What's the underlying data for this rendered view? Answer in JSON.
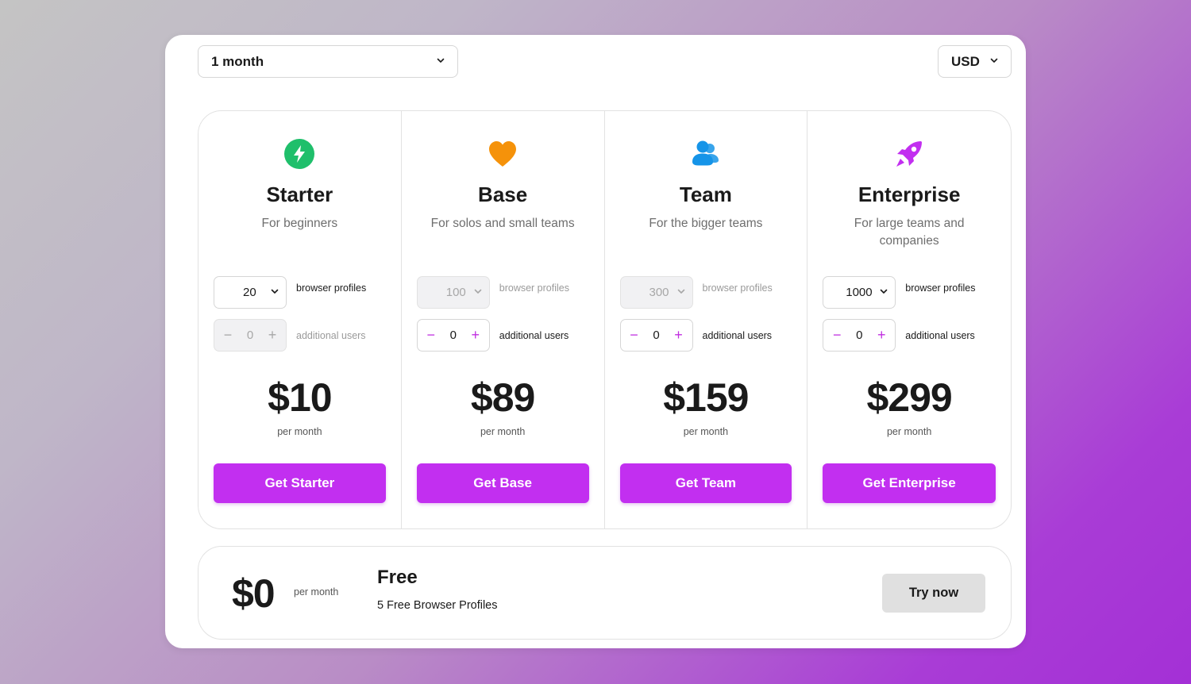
{
  "period_select": {
    "value": "1 month"
  },
  "currency_select": {
    "value": "USD"
  },
  "plans": [
    {
      "name": "Starter",
      "description": "For beginners",
      "icon": "lightning-icon",
      "icon_color": "#1fbf6b",
      "profiles": {
        "value": "20",
        "label": "browser profiles",
        "disabled": false
      },
      "users": {
        "value": "0",
        "minus": "−",
        "plus": "+",
        "label": "additional users",
        "disabled": true
      },
      "price": "$10",
      "per": "per month",
      "button": "Get Starter"
    },
    {
      "name": "Base",
      "description": "For solos and small teams",
      "icon": "heart-icon",
      "icon_color": "#f5920a",
      "profiles": {
        "value": "100",
        "label": "browser profiles",
        "disabled": true
      },
      "users": {
        "value": "0",
        "minus": "−",
        "plus": "+",
        "label": "additional users",
        "disabled": false
      },
      "price": "$89",
      "per": "per month",
      "button": "Get Base"
    },
    {
      "name": "Team",
      "description": "For the bigger teams",
      "icon": "users-icon",
      "icon_color": "#1594e8",
      "profiles": {
        "value": "300",
        "label": "browser profiles",
        "disabled": true
      },
      "users": {
        "value": "0",
        "minus": "−",
        "plus": "+",
        "label": "additional users",
        "disabled": false
      },
      "price": "$159",
      "per": "per month",
      "button": "Get Team"
    },
    {
      "name": "Enterprise",
      "description": "For large teams and companies",
      "icon": "rocket-icon",
      "icon_color": "#c22ff0",
      "profiles": {
        "value": "1000",
        "label": "browser profiles",
        "disabled": false
      },
      "users": {
        "value": "0",
        "minus": "−",
        "plus": "+",
        "label": "additional users",
        "disabled": false
      },
      "price": "$299",
      "per": "per month",
      "button": "Get Enterprise"
    }
  ],
  "free": {
    "price": "$0",
    "per": "per month",
    "title": "Free",
    "description": "5 Free Browser Profiles",
    "button": "Try now"
  },
  "colors": {
    "accent": "#c22ff0",
    "secondary_button": "#e0e0e0"
  }
}
